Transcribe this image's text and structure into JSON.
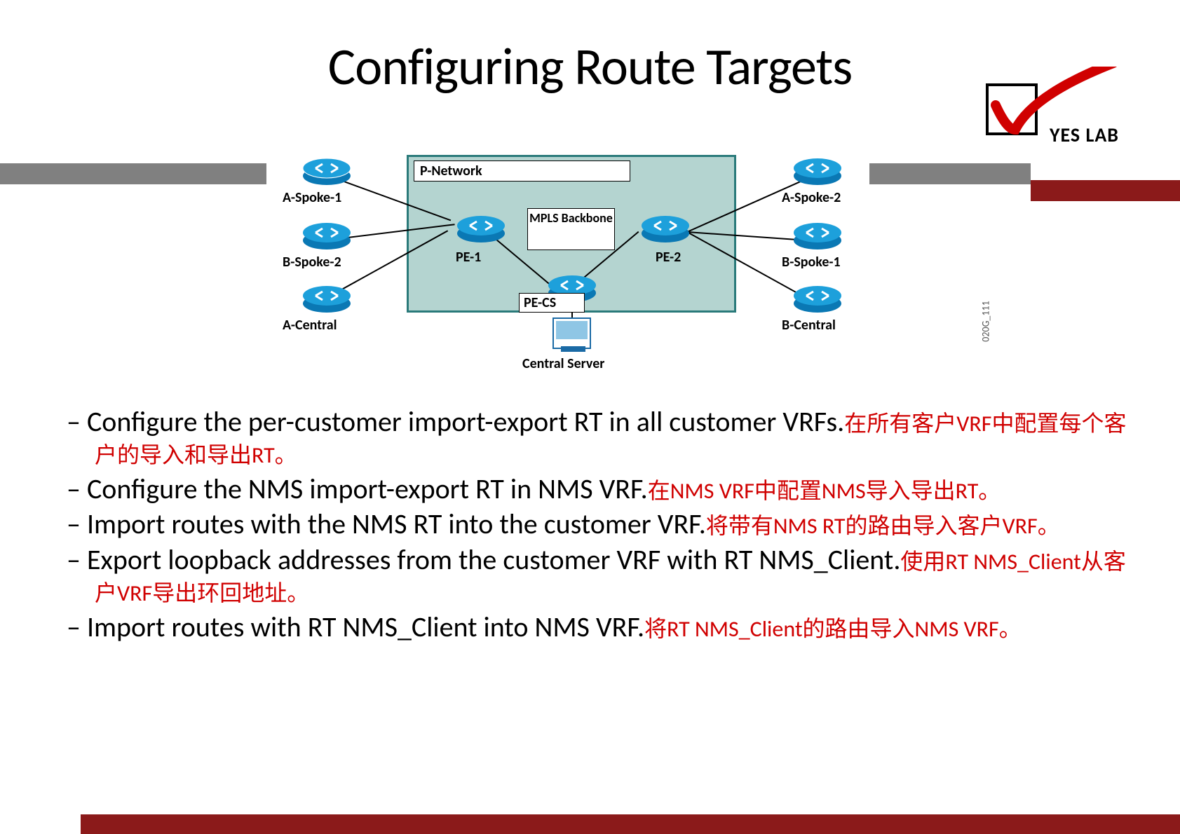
{
  "title": "Configuring Route Targets",
  "logo_text": "YES LAB",
  "diagram": {
    "pnet_label": "P-Network",
    "mpls_label": "MPLS Backbone",
    "routers": {
      "aspoke1": "A-Spoke-1",
      "bspoke2": "B-Spoke-2",
      "acentral": "A-Central",
      "aspoke2": "A-Spoke-2",
      "bspoke1": "B-Spoke-1",
      "bcentral": "B-Central",
      "pe1": "PE-1",
      "pe2": "PE-2",
      "pecs": "PE-CS"
    },
    "server_label": "Central Server",
    "image_code": "020G_111"
  },
  "bullets": [
    {
      "en": "Configure the per-customer import-export RT in all customer VRFs.",
      "cn": "在所有客户VRF中配置每个客户的导入和导出RT。"
    },
    {
      "en": "Configure the NMS import-export RT in NMS VRF.",
      "cn": "在NMS VRF中配置NMS导入导出RT。"
    },
    {
      "en": "Import routes with the NMS RT into the customer VRF.",
      "cn": "将带有NMS RT的路由导入客户VRF。"
    },
    {
      "en": "Export loopback addresses from the customer VRF with  RT NMS_Client.",
      "cn": "使用RT NMS_Client从客户VRF导出环回地址。"
    },
    {
      "en": "Import routes with RT NMS_Client into NMS VRF.",
      "cn": "将RT NMS_Client的路由导入NMS VRF。"
    }
  ]
}
